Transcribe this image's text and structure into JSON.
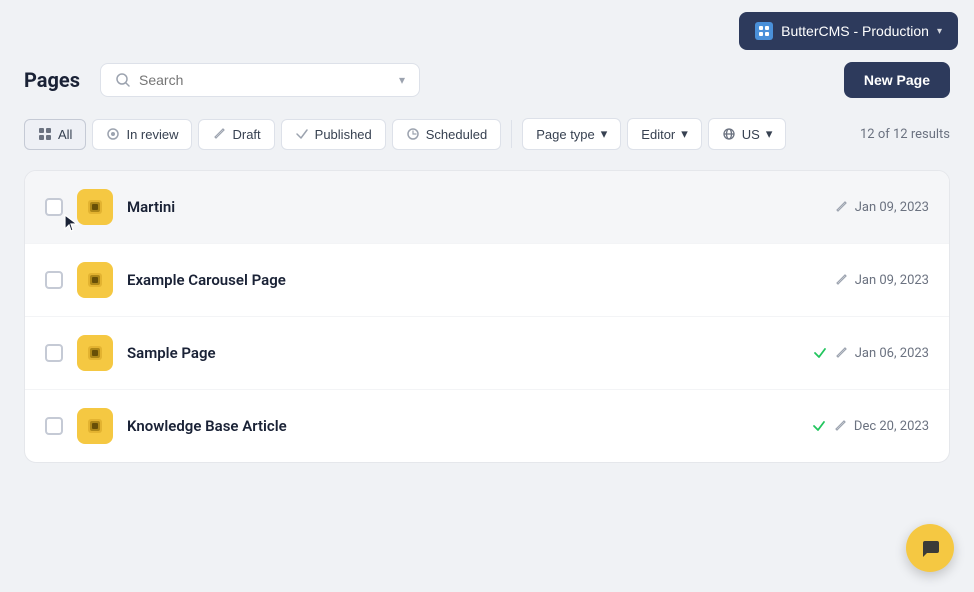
{
  "topbar": {
    "env_label": "ButterCMS - Production",
    "env_chevron": "▾"
  },
  "header": {
    "title": "Pages",
    "search_placeholder": "Search",
    "new_page_label": "New Page"
  },
  "filters": {
    "all_label": "All",
    "in_review_label": "In review",
    "draft_label": "Draft",
    "published_label": "Published",
    "scheduled_label": "Scheduled",
    "page_type_label": "Page type",
    "editor_label": "Editor",
    "locale_label": "US",
    "results_text": "12 of 12 results"
  },
  "pages": [
    {
      "name": "Martini",
      "date": "Jan 09, 2023",
      "published": false,
      "hovered": true
    },
    {
      "name": "Example Carousel Page",
      "date": "Jan 09, 2023",
      "published": false,
      "hovered": false
    },
    {
      "name": "Sample Page",
      "date": "Jan 06, 2023",
      "published": true,
      "hovered": false
    },
    {
      "name": "Knowledge Base Article",
      "date": "Dec 20, 2023",
      "published": true,
      "hovered": false
    }
  ],
  "chat": {
    "icon": "💬"
  }
}
